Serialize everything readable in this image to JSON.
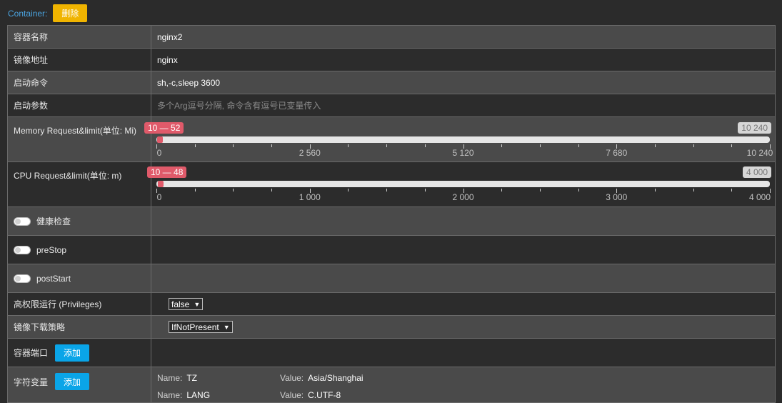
{
  "header": {
    "container_label": "Container:",
    "delete_label": "删除"
  },
  "fields": {
    "name": {
      "label": "容器名称",
      "value": "nginx2"
    },
    "image": {
      "label": "镜像地址",
      "value": "nginx"
    },
    "command": {
      "label": "启动命令",
      "value": "sh,-c,sleep 3600"
    },
    "args": {
      "label": "启动参数",
      "placeholder": "多个Arg逗号分隔, 命令含有逗号已变量传入"
    },
    "memory": {
      "label": "Memory Request&limit(单位: Mi)",
      "range_text": "10 — 52",
      "min": 10,
      "max_value": 52,
      "scale_max": 10240,
      "max_text": "10 240",
      "ticks": [
        "0",
        "2 560",
        "5 120",
        "7 680",
        "10 240"
      ]
    },
    "cpu": {
      "label": "CPU Request&limit(单位: m)",
      "range_text": "10 — 48",
      "min": 10,
      "max_value": 48,
      "scale_max": 4000,
      "max_text": "4 000",
      "ticks": [
        "0",
        "1 000",
        "2 000",
        "3 000",
        "4 000"
      ]
    },
    "health_check": {
      "label": "健康检查",
      "enabled": false
    },
    "prestop": {
      "label": "preStop",
      "enabled": false
    },
    "poststart": {
      "label": "postStart",
      "enabled": false
    },
    "privileges": {
      "label": "高权限运行 (Privileges)",
      "selected": "false"
    },
    "pull_policy": {
      "label": "镜像下载策略",
      "selected": "IfNotPresent"
    },
    "ports": {
      "label": "容器端口",
      "add_label": "添加"
    },
    "env": {
      "label": "字符变量",
      "add_label": "添加",
      "name_key": "Name:",
      "value_key": "Value:",
      "items": [
        {
          "name": "TZ",
          "value": "Asia/Shanghai"
        },
        {
          "name": "LANG",
          "value": "C.UTF-8"
        }
      ]
    }
  },
  "colors": {
    "accent_link": "#4aa3df",
    "delete_button": "#f0b400",
    "add_button": "#0aa5e8",
    "slider_selection": "#e05a6a"
  }
}
